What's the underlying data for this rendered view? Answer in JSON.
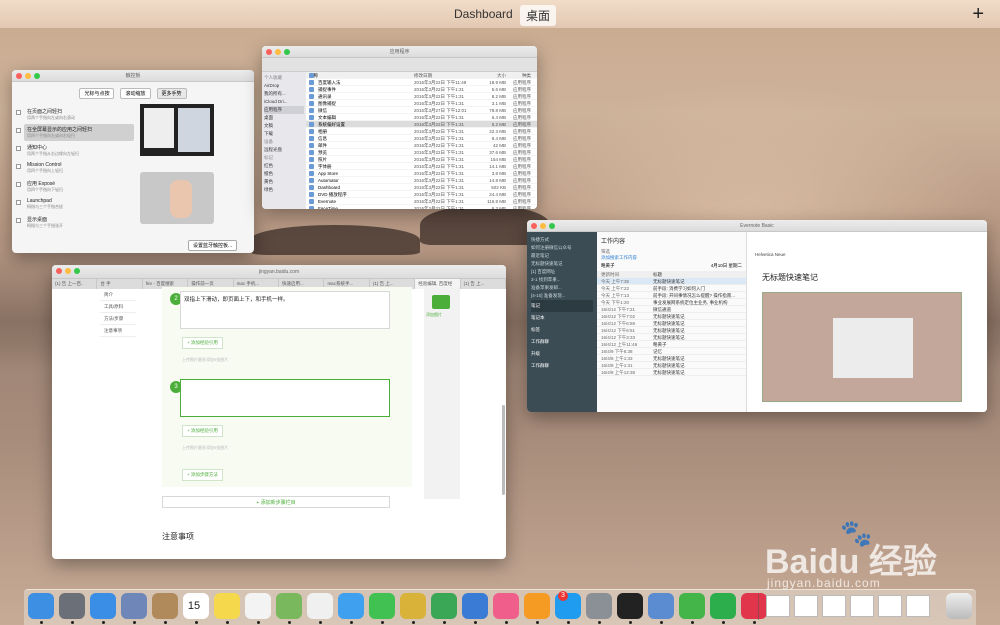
{
  "topbar": {
    "spaces": [
      "Dashboard",
      "桌面"
    ],
    "active_space": "桌面",
    "add_symbol": "+"
  },
  "prefs_window": {
    "title": "触控板",
    "tabs": [
      "光标与点按",
      "滚动缩放",
      "更多手势"
    ],
    "gestures": [
      {
        "title": "在页面之间轻扫",
        "desc": "用两个手指向左或向右滚动"
      },
      {
        "title": "在全屏幕显示的应用之间轻扫",
        "desc": "用四个手指向左或向右轻扫"
      },
      {
        "title": "通知中心",
        "desc": "用两个手指从右边缘向左轻扫"
      },
      {
        "title": "Mission Control",
        "desc": "用四个手指向上轻扫"
      },
      {
        "title": "应用 Exposé",
        "desc": "用四个手指向下轻扫"
      },
      {
        "title": "Launchpad",
        "desc": "拇指与三个手指合拢"
      },
      {
        "title": "显示桌面",
        "desc": "拇指与三个手指张开"
      }
    ],
    "button": "设置蓝牙触控板..."
  },
  "finder_window": {
    "title": "应用程序",
    "sidebar": [
      "个人收藏",
      "AirDrop",
      "我的所有...",
      "iCloud Dri...",
      "应用程序",
      "桌面",
      "文稿",
      "下载",
      "设备",
      "远程光盘",
      "标记",
      "红色",
      "橙色",
      "黄色",
      "绿色"
    ],
    "columns": [
      "名称",
      "修改日期",
      "大小",
      "种类"
    ],
    "rows": [
      {
        "name": "百度输入法",
        "date": "2016年3月22日 下午11:49",
        "size": "18.9 MB",
        "kind": "应用程序"
      },
      {
        "name": "捕捉事件",
        "date": "2016年3月22日 下午1:31",
        "size": "5.6 MB",
        "kind": "应用程序"
      },
      {
        "name": "通讯录",
        "date": "2016年3月22日 下午1:31",
        "size": "8.2 MB",
        "kind": "应用程序"
      },
      {
        "name": "图像捕捉",
        "date": "2016年3月22日 下午1:31",
        "size": "3.1 MB",
        "kind": "应用程序"
      },
      {
        "name": "微信",
        "date": "2016年3月27日 下午12:01",
        "size": "78.8 MB",
        "kind": "应用程序"
      },
      {
        "name": "文本编辑",
        "date": "2016年3月22日 下午1:31",
        "size": "6.4 MB",
        "kind": "应用程序"
      },
      {
        "name": "系统偏好设置",
        "date": "2016年3月22日 下午1:31",
        "size": "5.2 MB",
        "kind": "应用程序"
      },
      {
        "name": "相册",
        "date": "2016年3月22日 下午1:31",
        "size": "22.3 MB",
        "kind": "应用程序"
      },
      {
        "name": "信息",
        "date": "2016年3月22日 下午1:31",
        "size": "8.4 MB",
        "kind": "应用程序"
      },
      {
        "name": "邮件",
        "date": "2016年3月22日 下午1:31",
        "size": "42 MB",
        "kind": "应用程序"
      },
      {
        "name": "预览",
        "date": "2016年3月22日 下午1:31",
        "size": "37.6 MB",
        "kind": "应用程序"
      },
      {
        "name": "照片",
        "date": "2016年3月22日 下午1:31",
        "size": "154 MB",
        "kind": "应用程序"
      },
      {
        "name": "字体册",
        "date": "2016年3月22日 下午1:31",
        "size": "14.1 MB",
        "kind": "应用程序"
      },
      {
        "name": "App Store",
        "date": "2016年3月22日 下午1:31",
        "size": "3.8 MB",
        "kind": "应用程序"
      },
      {
        "name": "Automator",
        "date": "2016年3月22日 下午1:31",
        "size": "14.8 MB",
        "kind": "应用程序"
      },
      {
        "name": "Dashboard",
        "date": "2016年3月22日 下午1:31",
        "size": "502 KB",
        "kind": "应用程序"
      },
      {
        "name": "DVD 播放程序",
        "date": "2016年3月22日 下午1:31",
        "size": "24.4 MB",
        "kind": "应用程序"
      },
      {
        "name": "Evernote",
        "date": "2016年3月22日 下午1:31",
        "size": "116.8 MB",
        "kind": "应用程序"
      },
      {
        "name": "FaceTime",
        "date": "2016年3月22日 下午1:31",
        "size": "9.3 MB",
        "kind": "应用程序"
      }
    ]
  },
  "browser_window": {
    "url": "jingyan.baidu.com",
    "tabs": [
      "(1) 告 上一百..",
      "台 手",
      "fire - 百度搜索",
      "操作前一页",
      "mac 手机...",
      "快速启用...",
      "mac系统手...",
      "(1) 告 上...",
      "经验编辑, 百度经",
      "(1) 告 上..."
    ],
    "left_menu": [
      "简介",
      "工具/原料",
      "方法/步骤",
      "注意事项"
    ],
    "step2_text": "双指上下滑动，即页面上下，和手机一样。",
    "add_ref": "+ 添加经验引用",
    "upload_hint": "上传图片最多添加9张图片",
    "add_list": "+ 添加步骤方法",
    "add_step": "+ 添加新步骤栏目",
    "notes_heading": "注意事项",
    "step_numbers": [
      "2",
      "3"
    ],
    "right_label": "添加图片"
  },
  "evernote_window": {
    "title": "Evernote Basic",
    "nav": [
      "快捷方式",
      "如何注册微信公众号",
      "最近笔记",
      "无标题快速笔记",
      "[1] 百度网址",
      "3-1 找到苹果...",
      "准备苹果发邮...",
      "[4-10] 准备发现...",
      "笔记",
      "笔记本",
      "标签",
      "工作群聊",
      "升级",
      "工作群聊"
    ],
    "notebook": "工作内容",
    "group": "筛选",
    "filter": "添加搜索工作内容",
    "author": "略黄子",
    "date": "4月10日 星期二",
    "columns": [
      "更新时间",
      "标题"
    ],
    "rows": [
      {
        "time": "今天 上午7:35",
        "title": "无标题快速笔记"
      },
      {
        "time": "今天 上午7:22",
        "title": "前手段: 消费学习如何入门"
      },
      {
        "time": "今天 上午7:13",
        "title": "前手段: 开同事情况怎么提醒? 操作指南..."
      },
      {
        "time": "今天 下午1:20",
        "title": "事业发展网系统定位主业务, 事业机构"
      },
      {
        "time": "16/4/12 下午7:21",
        "title": "微信通道"
      },
      {
        "time": "16/4/12 下午7:02",
        "title": "无标题快速笔记"
      },
      {
        "time": "16/4/12 下午6:59",
        "title": "无标题快速笔记"
      },
      {
        "time": "16/4/12 下午6:51",
        "title": "无标题快速笔记"
      },
      {
        "time": "16/4/12 下午3:33",
        "title": "无标题快速笔记"
      },
      {
        "time": "16/4/12 上午11:46",
        "title": "略黄子"
      },
      {
        "time": "16/4/9 下午6:38",
        "title": "记忆"
      },
      {
        "time": "16/4/8 上午1:33",
        "title": "无标题快速笔记"
      },
      {
        "time": "16/4/8 上午1:31",
        "title": "无标题快速笔记"
      },
      {
        "time": "16/4/8 上午12:38",
        "title": "无标题快速笔记"
      }
    ],
    "note_title": "无标题快速笔记",
    "font": "Helvetica Neue"
  },
  "dock": {
    "apps": [
      "finder-icon",
      "launchpad-icon",
      "safari-icon",
      "photo-preview-icon",
      "contacts-icon",
      "calendar-icon",
      "notes-icon",
      "reminders-icon",
      "maps-icon",
      "photos-icon",
      "messages-icon",
      "facetime-icon",
      "keynote-icon",
      "numbers-icon",
      "keynote-present-icon",
      "itunes-icon",
      "ibooks-icon",
      "appstore-icon",
      "system-prefs-icon",
      "qq-icon",
      "preview-icon",
      "wechat-icon",
      "evernote-icon",
      "baidu-input-icon"
    ],
    "calendar_day": "15",
    "appstore_badge": "3"
  },
  "watermark": {
    "logo": "Baidu 经验",
    "url": "jingyan.baidu.com"
  },
  "colors": {
    "accent_green": "#4cae3a",
    "evernote_nav": "#3b4c55"
  }
}
